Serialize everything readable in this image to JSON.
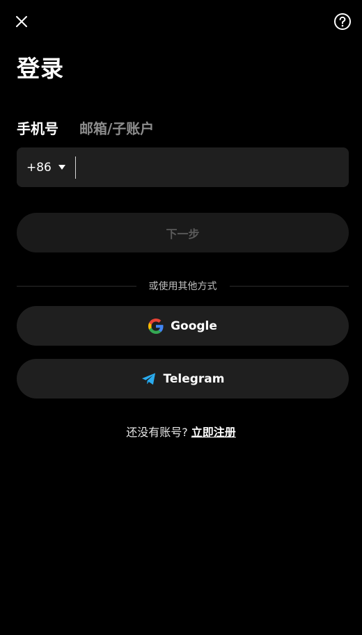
{
  "header": {
    "close_icon": "close-icon",
    "help_icon": "question-circle-icon"
  },
  "title": "登录",
  "tabs": [
    {
      "label": "手机号",
      "active": true
    },
    {
      "label": "邮箱/子账户",
      "active": false
    }
  ],
  "phone_field": {
    "country_code": "+86",
    "value": "",
    "placeholder": ""
  },
  "next_button": {
    "label": "下一步",
    "enabled": false
  },
  "divider": {
    "label": "或使用其他方式"
  },
  "oauth": {
    "google_label": "Google",
    "telegram_label": "Telegram"
  },
  "signup": {
    "prompt": "还没有账号?",
    "link": "立即注册"
  },
  "colors": {
    "background": "#000000",
    "field_bg": "#1f1f1f",
    "disabled_text": "#5a5a5a",
    "telegram_blue": "#2aabee"
  }
}
